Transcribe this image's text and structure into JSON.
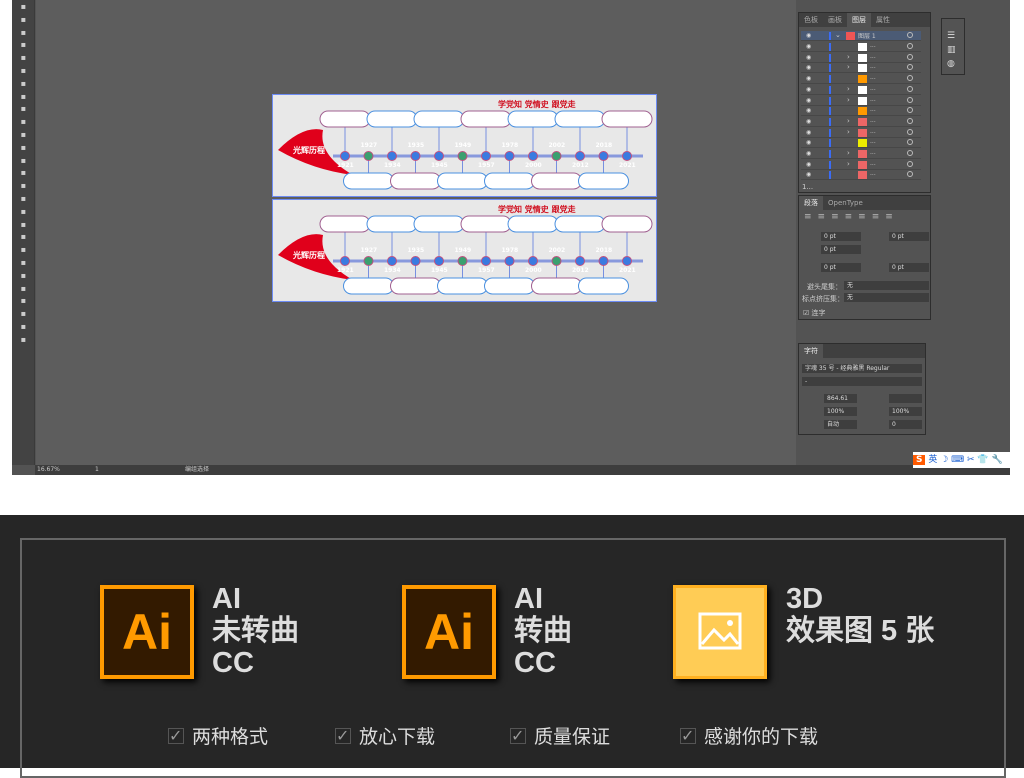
{
  "toolbar": {
    "tools": [
      "selection",
      "direct-selection",
      "pen",
      "curvature",
      "type",
      "line",
      "rectangle",
      "paintbrush",
      "shaper",
      "eraser",
      "rotate",
      "scale",
      "warp",
      "width",
      "puppet",
      "shape-builder",
      "perspective",
      "mesh",
      "gradient",
      "eyedropper",
      "blend",
      "symbol-sprayer",
      "column-graph",
      "artboard",
      "slice",
      "hand",
      "zoom"
    ],
    "more": "..."
  },
  "canvas": {
    "artboard_title": "学党知 党情史 跟党走",
    "logo_text": "光辉历程",
    "years": [
      "1921",
      "1927",
      "1934",
      "1935",
      "1945",
      "1949",
      "1957",
      "1978",
      "2000",
      "2002",
      "2012",
      "2018",
      "2021"
    ]
  },
  "status": {
    "zoom": "16.67%",
    "page": "1",
    "tool": "编组选择"
  },
  "layers_panel": {
    "tabs": [
      "色板",
      "画板",
      "图层",
      "属性"
    ],
    "active_tab": "图层",
    "top_layer": "图层 1",
    "row_dots": "...",
    "count": "1...",
    "rows": [
      "white",
      "white",
      "white",
      "orange",
      "white",
      "white",
      "orange",
      "red",
      "red",
      "yellow",
      "red",
      "red",
      "red"
    ]
  },
  "paragraph_panel": {
    "tabs": [
      "段落",
      "OpenType"
    ],
    "indent_left": "0 pt",
    "indent_right": "0 pt",
    "first_line": "0 pt",
    "space_before": "0 pt",
    "space_after": "0 pt",
    "kinsoku_label": "避头尾集：",
    "kinsoku_value": "无",
    "mojikumi_label": "标点挤压集：",
    "mojikumi_value": "无",
    "hyphen_label": "连字",
    "hyphen_checked": true
  },
  "character_panel": {
    "tab": "字符",
    "font": "字魂 35 号 - 经典雅黑 Regular",
    "style": "-",
    "size": "864.61",
    "leading": "",
    "vscale": "100%",
    "hscale": "100%",
    "kerning": "自动",
    "tracking": "0"
  },
  "ime": {
    "logo": "S",
    "lang": "英"
  },
  "promo": {
    "items": [
      {
        "icon": "Ai",
        "lines": [
          "AI",
          "未转曲",
          "CC"
        ]
      },
      {
        "icon": "Ai",
        "lines": [
          "AI",
          "转曲",
          "CC"
        ]
      },
      {
        "icon": "image-icon",
        "lines": [
          "3D",
          "效果图 5 张"
        ]
      }
    ],
    "checks": [
      "两种格式",
      "放心下载",
      "质量保证",
      "感谢你的下载"
    ],
    "colors": {
      "ai_orange": "#ff9a00",
      "ai_bg": "#331a00",
      "image_yellow": "#ffcc55"
    }
  }
}
